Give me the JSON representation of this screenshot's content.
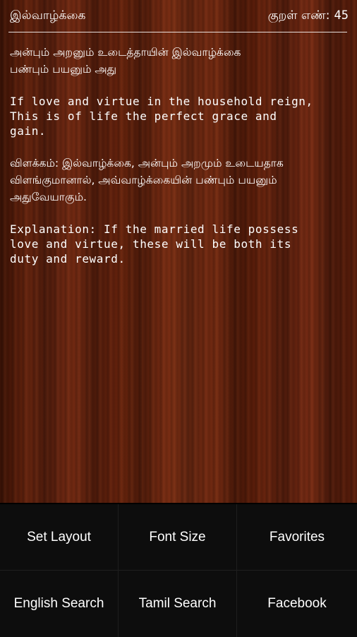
{
  "header": {
    "title": "இல்வாழ்க்கை",
    "kural_label": "குறள் எண்:",
    "kural_number": "45"
  },
  "kural": {
    "tamil_line1": "அன்பும் அறனும் உடைத்தாயின் இல்வாழ்க்கை",
    "tamil_line2": "பண்பும் பயனும் அது",
    "english_line1": "If love and virtue in the household reign,",
    "english_line2": "This is of life the perfect grace and",
    "english_line3": "gain.",
    "tamil_explanation_line1": "விளக்கம்: இல்வாழ்க்கை, அன்பும் அறமும் உடையதாக",
    "tamil_explanation_line2": "விளங்குமானால், அவ்வாழ்க்கையின் பண்பும் பயனும்",
    "tamil_explanation_line3": "அதுவேயாகும்.",
    "english_explanation_line1": "Explanation: If the married life possess",
    "english_explanation_line2": "love and virtue, these will be both its",
    "english_explanation_line3": "duty and reward."
  },
  "menu": {
    "set_layout": "Set Layout",
    "font_size": "Font Size",
    "favorites": "Favorites",
    "english_search": "English Search",
    "tamil_search": "Tamil Search",
    "facebook": "Facebook"
  }
}
